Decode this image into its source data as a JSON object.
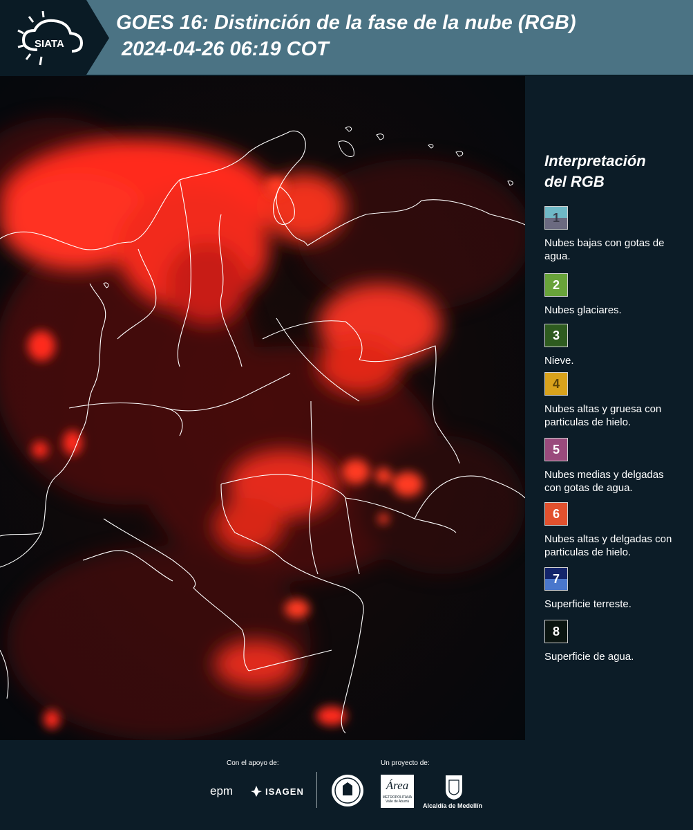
{
  "header": {
    "logo_text": "SIATA",
    "title_line1": "GOES 16: Distinción de la fase de la nube (RGB)",
    "title_line2": "2024-04-26 06:19 COT"
  },
  "legend": {
    "title_line1": "Interpretación",
    "title_line2": "del RGB",
    "items": [
      {
        "number": "1",
        "label": "Nubes bajas con gotas de agua.",
        "top_color": "#6fb8c6",
        "bottom_color": "#6b6a80",
        "text_color": "#3b3b4a"
      },
      {
        "number": "2",
        "label": "Nubes glaciares.",
        "top_color": "#69a33a",
        "bottom_color": "#69a33a",
        "text_color": "#ffffff"
      },
      {
        "number": "3",
        "label": "Nieve.",
        "top_color": "#2e5b1f",
        "bottom_color": "#2e5b1f",
        "text_color": "#ffffff"
      },
      {
        "number": "4",
        "label": "Nubes altas y gruesa con particulas de hielo.",
        "top_color": "#d9a21c",
        "bottom_color": "#d9a21c",
        "text_color": "#5a4308"
      },
      {
        "number": "5",
        "label": "Nubes medias y delgadas con gotas de agua.",
        "top_color": "#9a4a7c",
        "bottom_color": "#9a4a7c",
        "text_color": "#ffffff"
      },
      {
        "number": "6",
        "label": "Nubes altas y delgadas con particulas de hielo.",
        "top_color": "#e2512e",
        "bottom_color": "#e2512e",
        "text_color": "#ffffff"
      },
      {
        "number": "7",
        "label": "Superficie terreste.",
        "top_color": "#13246b",
        "bottom_color": "#4a77cc",
        "text_color": "#ffffff"
      },
      {
        "number": "8",
        "label": "Superficie de agua.",
        "top_color": "#0a1410",
        "bottom_color": "#0a1410",
        "text_color": "#ffffff"
      }
    ]
  },
  "footer": {
    "support_label": "Con el apoyo de:",
    "project_label": "Un proyecto de:",
    "epm": "epm",
    "isagen": "ISAGEN",
    "area_name": "Área",
    "area_sub1": "METROPOLITANA",
    "area_sub2": "Valle de Aburrá",
    "alcaldia": "Alcaldía de Medellín"
  },
  "colors": {
    "header_band": "#4b7384",
    "panel_bg": "#0c1c27",
    "cloud_red": "#ff2a1e",
    "border_white": "#ffffff"
  }
}
